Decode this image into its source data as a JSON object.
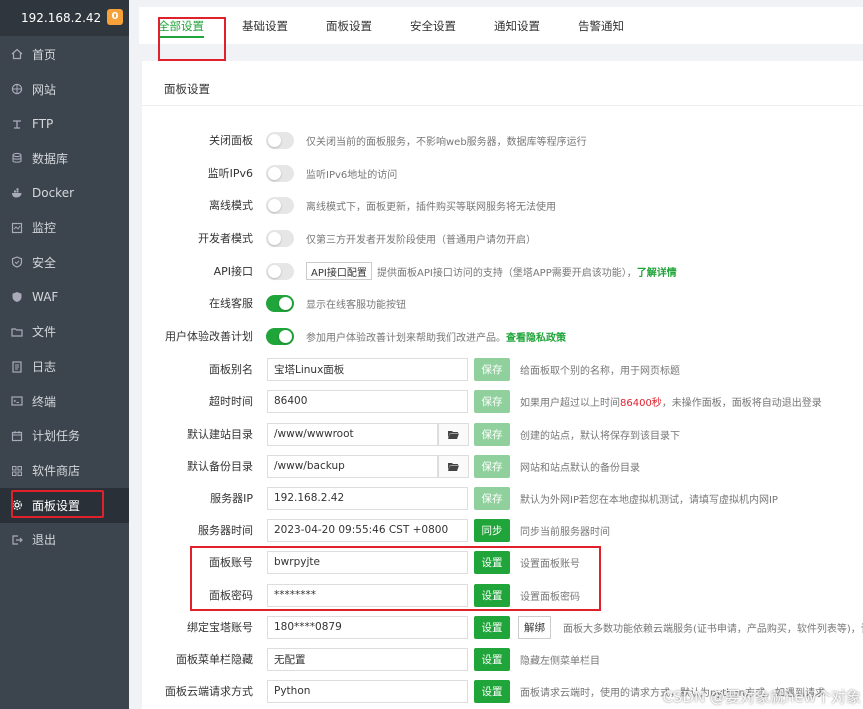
{
  "sidebar": {
    "ip": "192.168.2.42",
    "badge": "0",
    "items": [
      {
        "label": "首页",
        "icon": "home-icon"
      },
      {
        "label": "网站",
        "icon": "globe-icon"
      },
      {
        "label": "FTP",
        "icon": "ftp-icon"
      },
      {
        "label": "数据库",
        "icon": "database-icon"
      },
      {
        "label": "Docker",
        "icon": "docker-icon"
      },
      {
        "label": "监控",
        "icon": "monitor-icon"
      },
      {
        "label": "安全",
        "icon": "shield-icon"
      },
      {
        "label": "WAF",
        "icon": "waf-shield-icon"
      },
      {
        "label": "文件",
        "icon": "folder-icon"
      },
      {
        "label": "日志",
        "icon": "log-icon"
      },
      {
        "label": "终端",
        "icon": "terminal-icon"
      },
      {
        "label": "计划任务",
        "icon": "calendar-icon"
      },
      {
        "label": "软件商店",
        "icon": "grid-icon"
      },
      {
        "label": "面板设置",
        "icon": "gear-icon"
      },
      {
        "label": "退出",
        "icon": "logout-icon"
      }
    ]
  },
  "tabs": [
    {
      "label": "全部设置"
    },
    {
      "label": "基础设置"
    },
    {
      "label": "面板设置"
    },
    {
      "label": "安全设置"
    },
    {
      "label": "通知设置"
    },
    {
      "label": "告警通知"
    }
  ],
  "panel": {
    "title": "面板设置",
    "toggles": [
      {
        "label": "关闭面板",
        "on": false,
        "desc": "仅关闭当前的面板服务，不影响web服务器，数据库等程序运行"
      },
      {
        "label": "监听IPv6",
        "on": false,
        "desc": "监听IPv6地址的访问"
      },
      {
        "label": "离线模式",
        "on": false,
        "desc": "离线模式下，面板更新，插件购买等联网服务将无法使用"
      },
      {
        "label": "开发者模式",
        "on": false,
        "desc": "仅第三方开发者开发阶段使用（普通用户请勿开启）"
      },
      {
        "label": "API接口",
        "on": false,
        "button": "API接口配置",
        "desc": "提供面板API接口访问的支持（堡塔APP需要开启该功能），",
        "link": "了解详情"
      },
      {
        "label": "在线客服",
        "on": true,
        "desc": "显示在线客服功能按钮"
      },
      {
        "label": "用户体验改善计划",
        "on": true,
        "desc": "参加用户体验改善计划来帮助我们改进产品。",
        "link": "查看隐私政策"
      }
    ],
    "fields": {
      "alias": {
        "label": "面板别名",
        "value": "宝塔Linux面板",
        "button": "保存",
        "desc": "给面板取个别的名称，用于网页标题"
      },
      "timeout": {
        "label": "超时时间",
        "value": "86400",
        "button": "保存",
        "desc_a": "如果用户超过以上时间",
        "desc_red": "86400秒",
        "desc_b": "，未操作面板，面板将自动退出登录"
      },
      "site_dir": {
        "label": "默认建站目录",
        "value": "/www/wwwroot",
        "button": "保存",
        "desc": "创建的站点，默认将保存到该目录下"
      },
      "backup_dir": {
        "label": "默认备份目录",
        "value": "/www/backup",
        "button": "保存",
        "desc": "网站和站点默认的备份目录"
      },
      "server_ip": {
        "label": "服务器IP",
        "value": "192.168.2.42",
        "button": "保存",
        "desc": "默认为外网IP若您在本地虚拟机测试，请填写虚拟机内网IP"
      },
      "server_time": {
        "label": "服务器时间",
        "value": "2023-04-20 09:55:46 CST +0800",
        "button": "同步",
        "desc": "同步当前服务器时间"
      },
      "account": {
        "label": "面板账号",
        "value": "bwrpyjte",
        "button": "设置",
        "desc": "设置面板账号"
      },
      "password": {
        "label": "面板密码",
        "value": "********",
        "button": "设置",
        "desc": "设置面板密码"
      },
      "bind": {
        "label": "绑定宝塔账号",
        "value": "180****0879",
        "button": "设置",
        "button2": "解绑",
        "desc": "面板大多数功能依赖云端服务(证书申请，产品购买，软件列表等)，该功能"
      },
      "menu_hide": {
        "label": "面板菜单栏隐藏",
        "value": "无配置",
        "button": "设置",
        "desc": "隐藏左侧菜单栏目"
      },
      "cloud_method": {
        "label": "面板云端请求方式",
        "value": "Python",
        "button": "设置",
        "desc": "面板请求云端时，使用的请求方式，默认为python方式，如遇到请求"
      }
    }
  },
  "watermark": "CSDN @要对象就new个对象",
  "colors": {
    "accent": "#20a53a",
    "highlight": "#e0202b",
    "sidebar": "#3c444d"
  }
}
